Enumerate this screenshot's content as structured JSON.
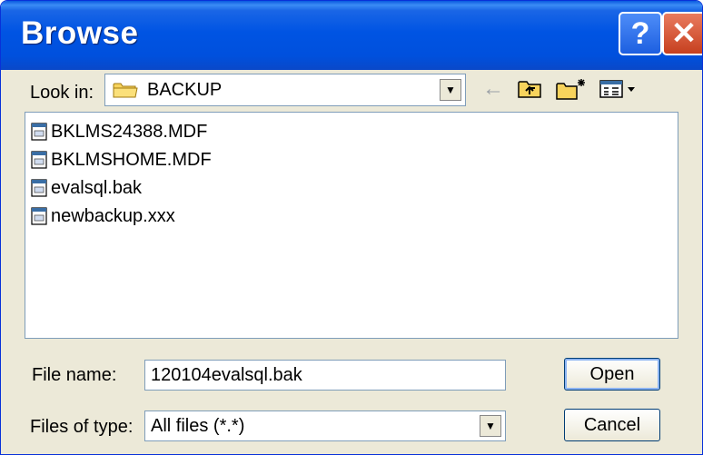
{
  "window": {
    "title": "Browse",
    "help_glyph": "?",
    "close_glyph": "✕"
  },
  "look_in": {
    "label": "Look in:",
    "value": "BACKUP",
    "folder_icon": "folder-icon"
  },
  "toolbar": {
    "back_glyph": "←",
    "icons": [
      "back-arrow-icon",
      "up-one-level-icon",
      "new-folder-icon",
      "view-menu-icon"
    ]
  },
  "files": [
    {
      "name": "BKLMS24388.MDF"
    },
    {
      "name": "BKLMSHOME.MDF"
    },
    {
      "name": "evalsql.bak"
    },
    {
      "name": "newbackup.xxx"
    }
  ],
  "file_name": {
    "label": "File name:",
    "value": "120104evalsql.bak"
  },
  "file_type": {
    "label": "Files of type:",
    "value": "All files (*.*)"
  },
  "buttons": {
    "open": "Open",
    "cancel": "Cancel"
  },
  "colors": {
    "titlebar": "#0054e3",
    "close": "#c6401f",
    "face": "#ece9d8",
    "border": "#7f9db9"
  }
}
